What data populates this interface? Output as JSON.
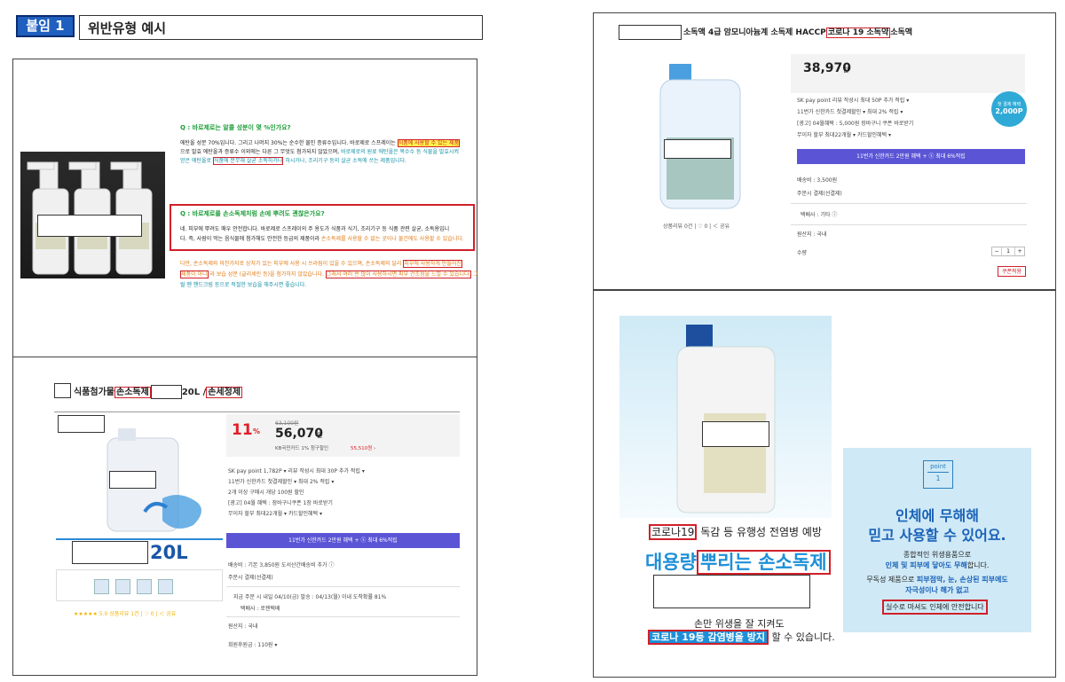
{
  "header": {
    "tag": "붙임 1",
    "title": "위반유형 예시"
  },
  "panel_qa": {
    "q1": "Q : 바로제로는 알콜 성분이 몇 %인가요?",
    "a1_l1": "에탄올 성분 70%입니다.  그리고 나머지 30%는 순수한 물인 증류수입니다.  바로제로 스프레이는",
    "a1_hl": "식품에 사용할 수 있는 제품",
    "a1_l2": "으로 발효 에탄올과 증류수 이외에는 다른 그 무엇도 첨가되지 않았으며,",
    "a1_l2b": "바로제로의 원료 에탄올은 목수수 등 식물을 발효시켜",
    "a1_l3": "얻은 에탄올로",
    "a1_hl2": "식품에 분무해 살균 소독하거나",
    "a1_l3b": "하시거나, 조리기구 등의 살균 소독에 쓰는 제품입니다.",
    "q2": "Q : 바로제로를 손소독제처럼 손에 뿌려도 괜찮은가요?",
    "a2_l1": "네. 피부에 뿌려도 매우 안전합니다.  바로제로 스프레이의 주 용도가 식품과 식기, 조리기구 등 식품 관련 살균, 소독용입니",
    "a2_l2": "다.  즉, 사람이 먹는 음식물에 첨가해도 안전한 등급의 제품이라",
    "a2_l2b": "손소독제를 사용할 수 없는 곳이나 물건에도 사용할 수 있습니다.",
    "a3_l1": "다만, 손소독제와 마찬가지로 상처가 있는 피부에 사용 시 쓰라림이 있을 수 있으며, 손소독제와 달리",
    "a3_hl1": "피부에 사용하게 만들어진",
    "a3_hl2": "제품이 아니",
    "a3_l2": "라 보습 성분 (글리세린 등)을 첨가하지 않았습니다.",
    "a3_hl3": "그래서 여러 번 많이 사용하시면 피부 건조함을 느낄 수 있습니다.",
    "a3_l2b": "그",
    "a3_l3": "럴 땐 핸드크림 등으로 적절한 보습을 해주시면 좋습니다."
  },
  "panel_20l": {
    "title_a": "식품첨가물",
    "title_b": "손소독제",
    "title_c": "20L /",
    "title_d": "손세정제",
    "discount": "11",
    "pct": "%",
    "orig_price": "63,100원",
    "price": "56,070",
    "won": "원",
    "card_line": "KB국민카드 1% 청구할인",
    "card_amt": "55,510원 ›",
    "rows": [
      "SK pay point 1,782P  ▾     리뷰 작성시 최대 30P 추가 적립  ▾",
      "11번가 신한카드 첫결제할인  ▾     최대 2% 적립  ▾",
      "2개 이상 구매시 개당 100원 할인",
      "[광고] 04월 혜택 : 장바구니쿠폰 1장 바로받기",
      "무이자 할부 최대22개월  ▾     카드할인혜택  ▾"
    ],
    "btn": "11번가 신한카드 2만원 혜택 + ⓢ 최대 6%적립",
    "ship1": "배송비 : 기본 3,850원     도서산간배송비 추가 ⓘ",
    "ship2": "주문시 결제(선결제)",
    "deliv": "지금 주문 시 내일 04/10(금) 발송 :  04/13(월) 이내 도착확률 81%",
    "carrier": "택배사 : 로젠택배",
    "origin": "원산지 : 국내",
    "points": "회원후원금 : 110원  ▾",
    "size": "20L",
    "rating": "★★★★★ 5.0   상품리뷰 1건  |  ♡ 0  |  ＜ 공유"
  },
  "panel_4l": {
    "t1": "소독액 4급 암모니아늄계 소독제 HACCP",
    "t_hl": "코로나 19 소독약",
    "t2": "소독액",
    "price": "38,970",
    "won": "원",
    "badge_l1": "첫 결제 혜택",
    "badge_l2": "2,000P",
    "rows": [
      "SK pay point 리뷰 작성시 최대 50P 추가 적립  ▾",
      "11번가 신한카드 첫결제할인  ▾     최대 2% 적립  ▾",
      "[광고] 04월혜택 : 5,000원 장바구니 쿠폰 바로받기",
      "무이자 할부 최대22개월  ▾     카드할인혜택  ▾"
    ],
    "btn": "11번가 신한카드 2만원 혜택 + ⓢ 최대 6%적립",
    "ship1": "배송비 : 3,500원",
    "ship2": "주문시 결제(선결제)",
    "carrier": "택배사 : 기타 ⓘ",
    "origin": "원산지 : 국내",
    "qty_label": "수량",
    "qty": "1",
    "coupon": "쿠폰적용",
    "social": "상품리뷰 0건  |  ♡ 0  |  ＜ 공유"
  },
  "panel_ad": {
    "line1_hl": "코로나19",
    "line1": "독감 등 유행성 전염병 예방",
    "big1": "대용량",
    "big_hl": "뿌리는 손소독제",
    "line2": "손만 위생을 잘 지켜도",
    "line3_hl": "코로나 19등 감염병을 방지",
    "line3": "할 수 있습니다.",
    "point_label": "point",
    "point_num": "1",
    "card_big1": "인체에 무해해",
    "card_big2": "믿고 사용할 수 있어요.",
    "c1": "종합적인 위생용품으로",
    "c2a": "인체 및 피부에 닿아도 무해",
    "c2b": "합니다.",
    "c3a": "무독성 제품으로",
    "c3b": "피부점막, 눈, 손상된 피부에도",
    "c4": "자극성이나 해가 없고",
    "c5": "실수로 마셔도 인체에 안전합니다"
  }
}
